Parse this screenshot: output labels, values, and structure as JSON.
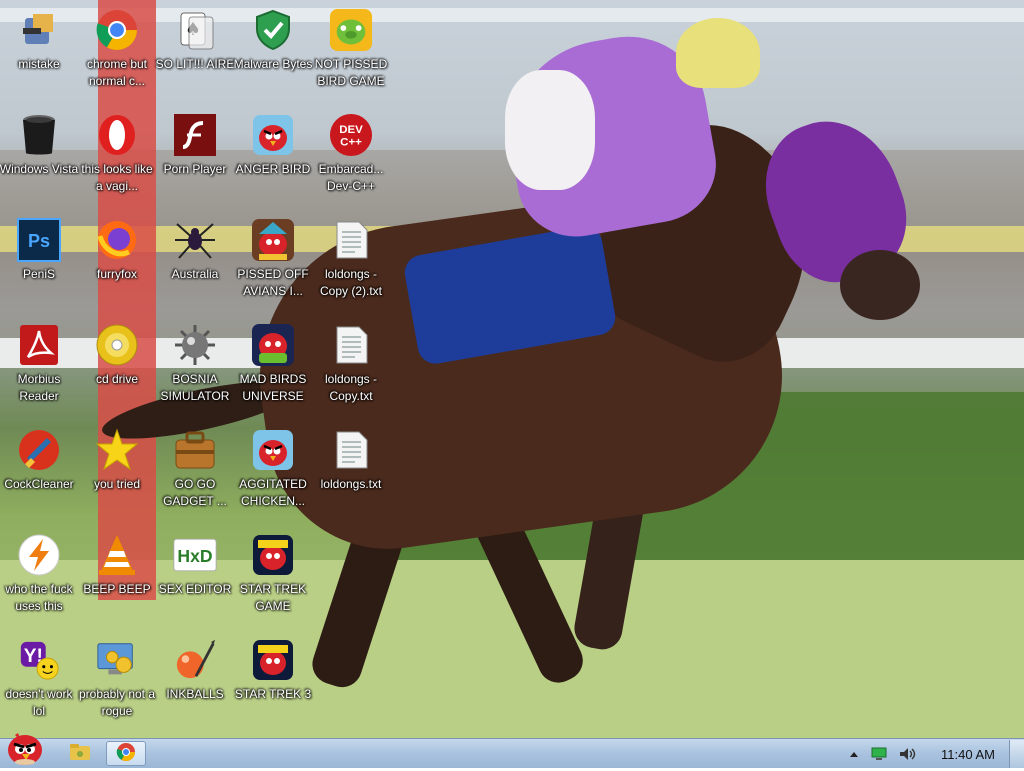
{
  "desktop": {
    "icons": [
      {
        "label": "mistake",
        "icon": "installer-icon"
      },
      {
        "label": "chrome but normal c...",
        "icon": "chrome-icon"
      },
      {
        "label": "SO LIT!!! AIRE",
        "icon": "solitaire-icon"
      },
      {
        "label": "Malware Bytes",
        "icon": "shield-check-icon"
      },
      {
        "label": "NOT PISSED BIRD GAME",
        "icon": "green-pig-icon"
      },
      {
        "label": "Windows Vista",
        "icon": "trash-bin-icon"
      },
      {
        "label": "this looks like a vagi...",
        "icon": "opera-icon"
      },
      {
        "label": "Porn Player",
        "icon": "flash-icon"
      },
      {
        "label": "ANGER BIRD",
        "icon": "angry-bird-icon"
      },
      {
        "label": "Embarcad... Dev-C++",
        "icon": "devcpp-icon"
      },
      {
        "label": "PeniS",
        "icon": "photoshop-icon"
      },
      {
        "label": "furryfox",
        "icon": "firefox-icon"
      },
      {
        "label": "Australia",
        "icon": "spider-icon"
      },
      {
        "label": "PISSED OFF AVIANS I...",
        "icon": "angry-birds-seasons-icon"
      },
      {
        "label": "loldongs - Copy (2).txt",
        "icon": "text-file-icon"
      },
      {
        "label": "Morbius Reader",
        "icon": "acrobat-icon"
      },
      {
        "label": "cd drive",
        "icon": "cd-icon"
      },
      {
        "label": "BOSNIA SIMULATOR",
        "icon": "mine-icon"
      },
      {
        "label": "MAD BIRDS UNIVERSE",
        "icon": "angry-birds-space-icon"
      },
      {
        "label": "loldongs - Copy.txt",
        "icon": "text-file-icon"
      },
      {
        "label": "CockCleaner",
        "icon": "ccleaner-icon"
      },
      {
        "label": "you tried",
        "icon": "star-icon"
      },
      {
        "label": "GO GO GADGET ...",
        "icon": "briefcase-icon"
      },
      {
        "label": "AGGITATED CHICKEN...",
        "icon": "angry-bird-icon"
      },
      {
        "label": "loldongs.txt",
        "icon": "text-file-icon"
      },
      {
        "label": "who the fuck uses this",
        "icon": "lightning-icon"
      },
      {
        "label": "BEEP BEEP",
        "icon": "vlc-cone-icon"
      },
      {
        "label": "SEX EDITOR",
        "icon": "hxd-icon"
      },
      {
        "label": "STAR TREK GAME",
        "icon": "angry-birds-starwars-icon"
      },
      {
        "label": "doesn't work lol",
        "icon": "yahoo-messenger-icon"
      },
      {
        "label": "probably not a rogue",
        "icon": "control-panel-icon"
      },
      {
        "label": "INKBALLS",
        "icon": "inkball-icon"
      },
      {
        "label": "STAR TREK 3",
        "icon": "angry-birds-starwars-icon"
      }
    ]
  },
  "taskbar": {
    "start_icon": "angry-bird-start-icon",
    "pinned": [
      {
        "icon": "explorer-folder-icon",
        "active": false
      },
      {
        "icon": "chrome-icon",
        "active": true
      }
    ],
    "tray": {
      "clock": "11:40 AM",
      "icons": [
        "show-hidden-chevron-icon",
        "network-icon",
        "volume-icon"
      ]
    }
  }
}
